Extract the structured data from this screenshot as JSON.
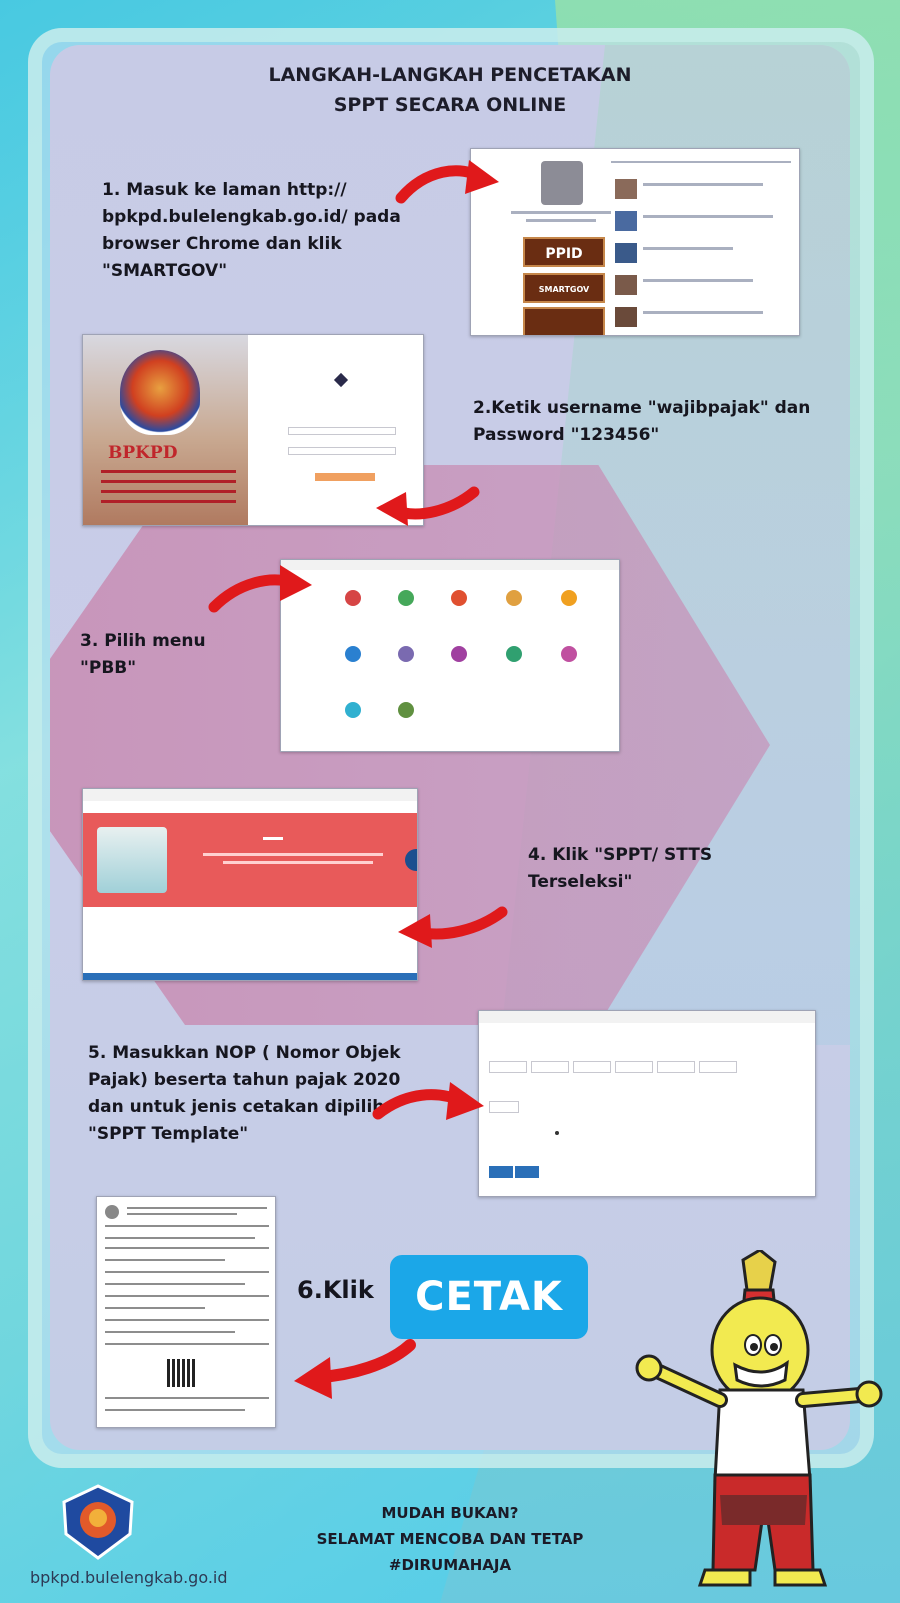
{
  "title": {
    "line1": "LANGKAH-LANGKAH PENCETAKAN",
    "line2": "SPPT SECARA ONLINE"
  },
  "steps": [
    {
      "lines": [
        "1. Masuk ke laman http://",
        "bpkpd.bulelengkab.go.id/ pada",
        "browser Chrome dan  klik",
        "\"SMARTGOV\""
      ]
    },
    {
      "lines": [
        "2.Ketik username \"wajibpajak\" dan",
        "Password \"123456\""
      ]
    },
    {
      "lines": [
        "3. Pilih menu",
        "\"PBB\""
      ]
    },
    {
      "lines": [
        "4. Klik \"SPPT/ STTS",
        "Terseleksi\""
      ]
    },
    {
      "lines": [
        "5. Masukkan NOP ( Nomor Objek",
        "Pajak) beserta tahun pajak 2020",
        "dan untuk jenis cetakan dipilih",
        "\"SPPT Template\""
      ]
    }
  ],
  "step6": {
    "label": "6.Klik",
    "button": "CETAK"
  },
  "screenshot1": {
    "buttons": [
      "PPID",
      "SMARTGOV",
      ""
    ]
  },
  "screenshot2": {
    "brand": "BPKPD"
  },
  "footer": {
    "line1": "MUDAH BUKAN?",
    "line2": "SELAMAT MENCOBA DAN TETAP",
    "line3": "#DIRUMAHAJA"
  },
  "website": "bpkpd.bulelengkab.go.id",
  "colors": {
    "accent": "#1ba7e8",
    "arrow": "#e0191b",
    "text": "#16161f"
  }
}
